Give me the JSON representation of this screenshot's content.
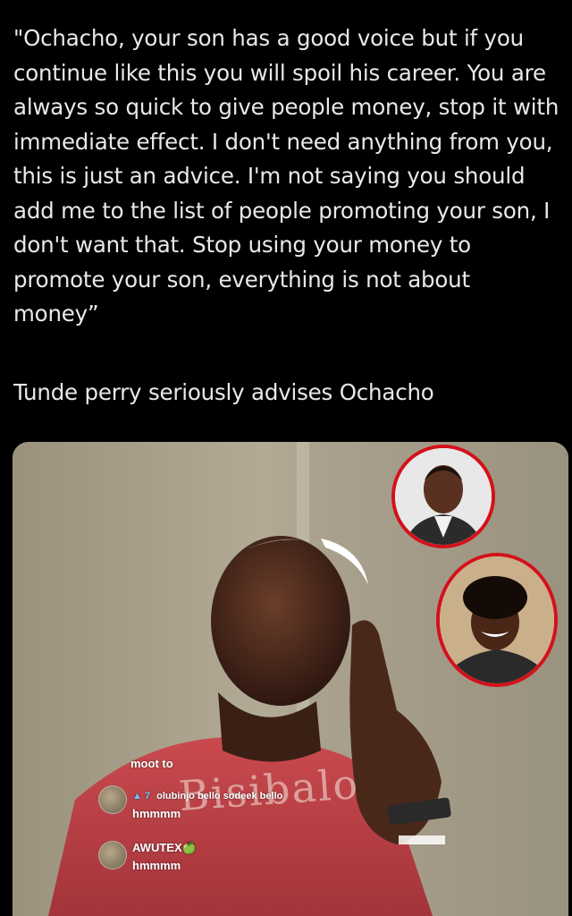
{
  "tweet": {
    "quote": "\"Ochacho, your son has a good voice but if you continue like this you will spoil his career. You are always so quick to give people money, stop it with immediate effect. I don't need anything from you, this is just an advice. I'm not saying you should add me to the list of people promoting your son, I don't want that. Stop using your money to promote your son, everything is not about money”",
    "caption": "Tunde perry seriously advises Ochacho"
  },
  "media": {
    "watermark": "Bisibalo",
    "chat": [
      {
        "text": "moot to"
      },
      {
        "badge": "▲ 7",
        "user": "olubinjo bello sodeek bello",
        "text": "hmmmm"
      },
      {
        "user": "AWUTEX🍏",
        "text": "hmmmm"
      }
    ]
  },
  "colors": {
    "background": "#000000",
    "text": "#e7e9ea",
    "inset_border": "#d4111a"
  }
}
